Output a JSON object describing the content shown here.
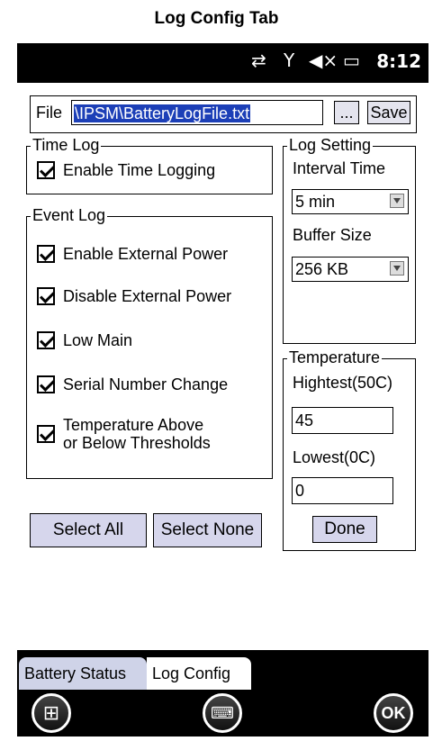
{
  "caption": "Log Config Tab",
  "status_bar": {
    "time": "8:12"
  },
  "file": {
    "label": "File",
    "value": "\\IPSM\\BatteryLogFile.txt",
    "browse_label": "...",
    "save_label": "Save"
  },
  "time_log": {
    "title": "Time Log",
    "enable_label": "Enable Time Logging",
    "enable_checked": true
  },
  "event_log": {
    "title": "Event Log",
    "items": [
      {
        "label": "Enable External Power",
        "checked": true
      },
      {
        "label": "Disable External Power",
        "checked": true
      },
      {
        "label": "Low Main",
        "checked": true
      },
      {
        "label": "Serial Number Change",
        "checked": true
      },
      {
        "label_line1": "Temperature Above",
        "label_line2": "or Below Thresholds",
        "checked": true
      }
    ]
  },
  "log_setting": {
    "title": "Log Setting",
    "interval_label": "Interval Time",
    "interval_value": "5 min",
    "buffer_label": "Buffer Size",
    "buffer_value": "256 KB"
  },
  "temperature": {
    "title": "Temperature",
    "highest_label": "Hightest(50C)",
    "highest_value": "45",
    "lowest_label": "Lowest(0C)",
    "lowest_value": "0",
    "done_label": "Done"
  },
  "buttons": {
    "select_all": "Select All",
    "select_none": "Select None"
  },
  "tabs": [
    {
      "label": "Battery Status",
      "active": false
    },
    {
      "label": "Log Config",
      "active": true
    }
  ],
  "softkeys": {
    "ok_label": "OK"
  }
}
